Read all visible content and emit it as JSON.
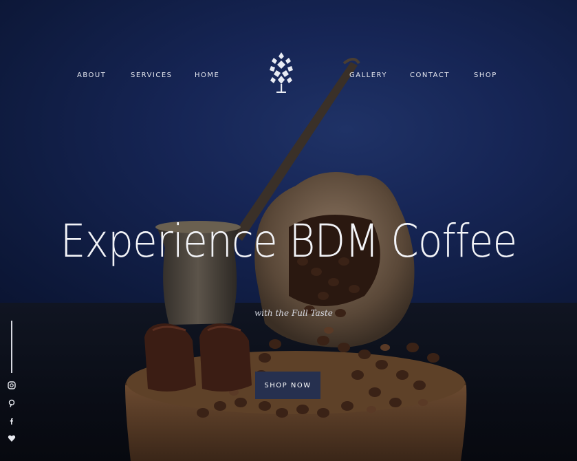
{
  "nav": {
    "items": [
      "ABOUT",
      "SERVICES",
      "HOME",
      "GALLERY",
      "CONTACT",
      "SHOP"
    ]
  },
  "logo": {
    "icon": "tree-logo-icon"
  },
  "hero": {
    "headline": "Experience BDM Coffee",
    "tagline": "with the Full Taste",
    "cta_label": "SHOP NOW",
    "cta_color": "#26304f"
  },
  "social": {
    "icons": [
      "instagram-icon",
      "pinterest-icon",
      "facebook-icon",
      "heart-icon"
    ]
  },
  "colors": {
    "wall": "#162555",
    "table": "#0a0d16",
    "text": "#f3f4f8"
  }
}
